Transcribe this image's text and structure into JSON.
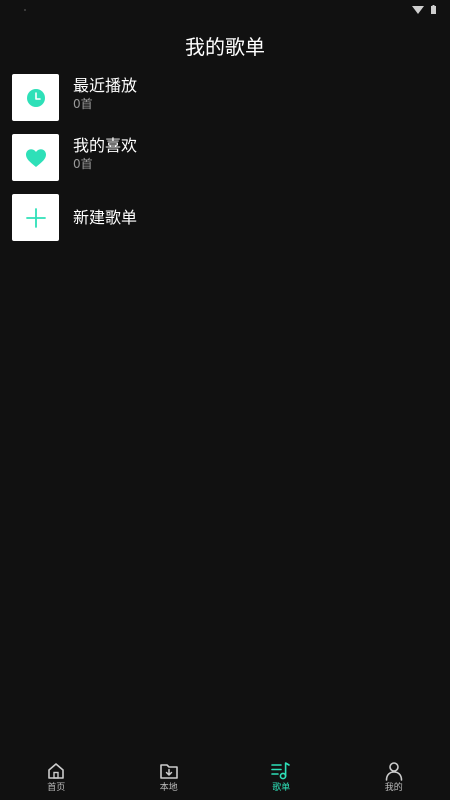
{
  "colors": {
    "accent": "#2ee0b8",
    "background": "#111111",
    "text_primary": "#ffffff",
    "text_secondary": "#9a9a9a",
    "nav_inactive": "#bbbbbb"
  },
  "header": {
    "title": "我的歌单"
  },
  "playlists": [
    {
      "name": "最近播放",
      "count": "0首",
      "icon": "clock-icon"
    },
    {
      "name": "我的喜欢",
      "count": "0首",
      "icon": "heart-icon"
    },
    {
      "name": "新建歌单",
      "icon": "plus-icon"
    }
  ],
  "bottom_nav": {
    "items": [
      {
        "label": "首页",
        "icon": "home-icon",
        "active": false
      },
      {
        "label": "本地",
        "icon": "folder-download-icon",
        "active": false
      },
      {
        "label": "歌单",
        "icon": "playlist-icon",
        "active": true
      },
      {
        "label": "我的",
        "icon": "user-icon",
        "active": false
      }
    ]
  }
}
